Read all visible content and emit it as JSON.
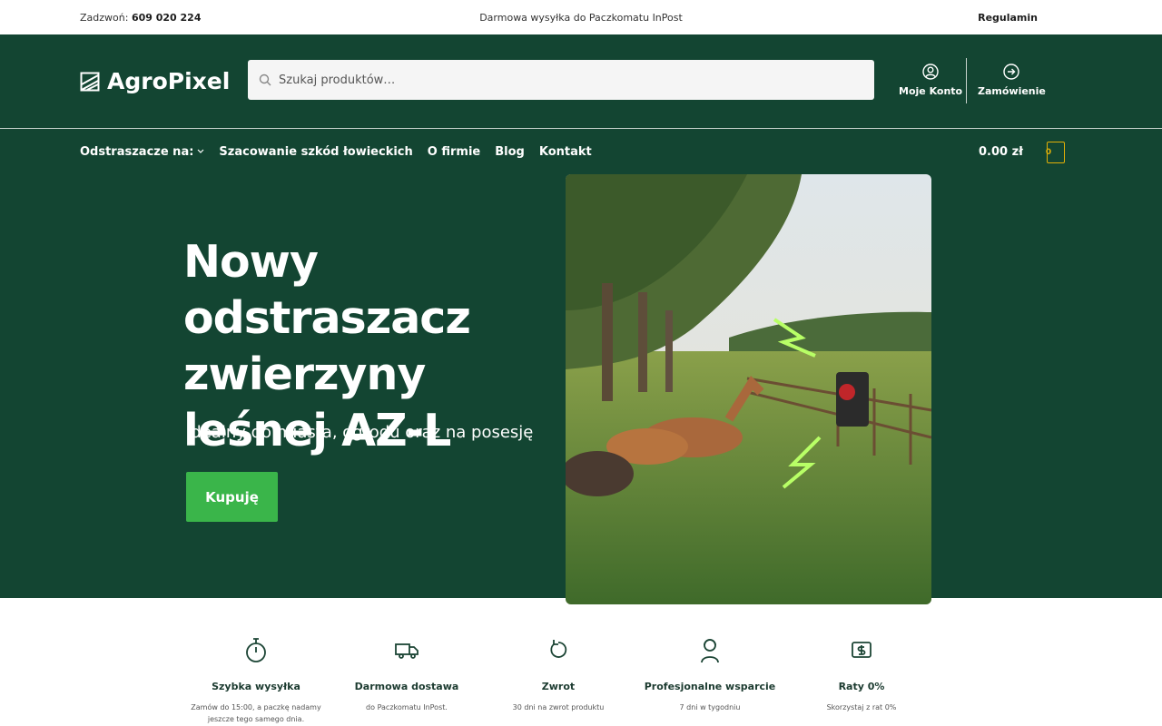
{
  "topbar": {
    "phone_label": "Zadzwoń:",
    "phone_number": "609 020 224",
    "shipping_note": "Darmowa wysyłka do Paczkomatu InPost",
    "terms_link": "Regulamin"
  },
  "header": {
    "logo_text": "AgroPixel",
    "search_placeholder": "Szukaj produktów…",
    "account_label": "Moje Konto",
    "order_label": "Zamówienie"
  },
  "nav": {
    "items": [
      "Odstraszacze na:",
      "Szacowanie szkód łowieckich",
      "O firmie",
      "Blog",
      "Kontakt"
    ],
    "cart_total": "0.00 zł",
    "cart_count": "0"
  },
  "hero": {
    "title": "Nowy odstraszacz zwierzyny leśnej AZ-L",
    "subtitle": "Idealny do miasta, ogrodu oraz na posesję",
    "cta": "Kupuję"
  },
  "features": [
    {
      "icon": "stopwatch-icon",
      "title": "Szybka wysyłka",
      "desc_1": "Zamów do 15:00, a paczkę nadamy",
      "desc_2": "jeszcze tego samego dnia."
    },
    {
      "icon": "delivery-truck-icon",
      "title": "Darmowa dostawa",
      "desc_1": "do Paczkomatu InPost.",
      "desc_2": ""
    },
    {
      "icon": "return-arrow-icon",
      "title": "Zwrot",
      "desc_1": "30 dni na zwrot produktu",
      "desc_2": ""
    },
    {
      "icon": "support-headset-icon",
      "title": "Profesjonalne wsparcie",
      "desc_1": "7 dni w tygodniu",
      "desc_2": ""
    },
    {
      "icon": "installment-money-icon",
      "title": "Raty 0%",
      "desc_1": "Skorzystaj z rat 0%",
      "desc_2": ""
    }
  ],
  "colors": {
    "brand_green": "#134532",
    "cta_green": "#3ab54a",
    "cart_yellow": "#e2b007"
  }
}
